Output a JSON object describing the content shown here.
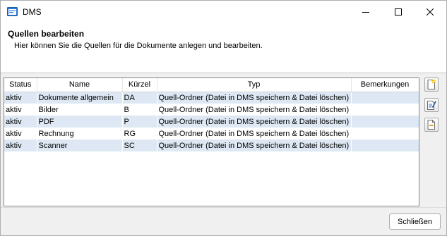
{
  "window": {
    "title": "DMS"
  },
  "header": {
    "title": "Quellen bearbeiten",
    "subtitle": "Hier können Sie die Quellen für die Dokumente anlegen und bearbeiten."
  },
  "table": {
    "columns": [
      "Status",
      "Name",
      "Kürzel",
      "Typ",
      "Bemerkungen"
    ],
    "rows": [
      [
        "aktiv",
        "Dokumente allgemein",
        "DA",
        "Quell-Ordner (Datei in DMS speichern & Datei löschen)",
        ""
      ],
      [
        "aktiv",
        "Bilder",
        "B",
        "Quell-Ordner (Datei in DMS speichern & Datei löschen)",
        ""
      ],
      [
        "aktiv",
        "PDF",
        "P",
        "Quell-Ordner (Datei in DMS speichern & Datei löschen)",
        ""
      ],
      [
        "aktiv",
        "Rechnung",
        "RG",
        "Quell-Ordner (Datei in DMS speichern & Datei löschen)",
        ""
      ],
      [
        "aktiv",
        "Scanner",
        "SC",
        "Quell-Ordner (Datei in DMS speichern & Datei löschen)",
        ""
      ]
    ]
  },
  "side_buttons": [
    {
      "icon": "new-document-icon"
    },
    {
      "icon": "edit-document-icon"
    },
    {
      "icon": "remove-document-icon"
    }
  ],
  "footer": {
    "close_label": "Schließen"
  },
  "colors": {
    "row_highlight": "#dde8f4",
    "body_background": "#f0f0f0"
  }
}
